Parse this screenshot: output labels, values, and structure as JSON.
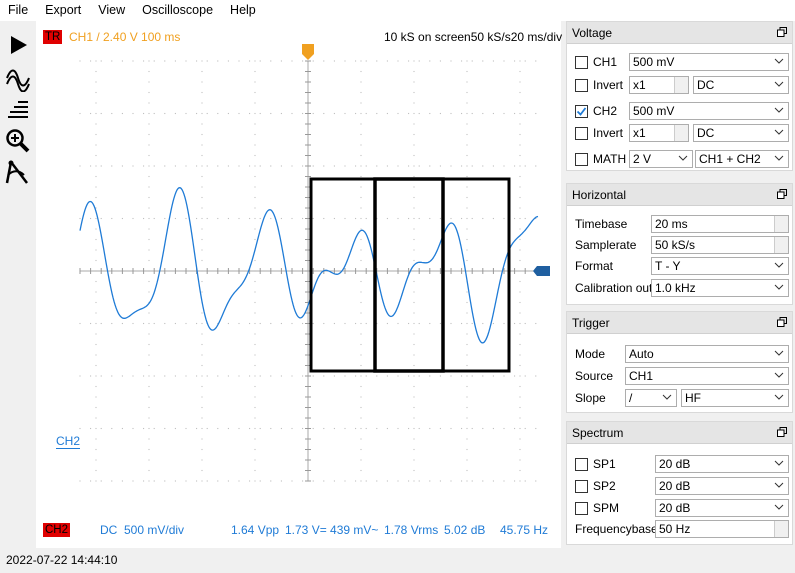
{
  "menu": [
    "File",
    "Export",
    "View",
    "Oscilloscope",
    "Help"
  ],
  "toolbar": [
    {
      "name": "run-icon"
    },
    {
      "name": "waveform-icon"
    },
    {
      "name": "filter-lines-icon"
    },
    {
      "name": "zoom-icon"
    },
    {
      "name": "measure-cursor-icon"
    }
  ],
  "scope": {
    "trigger_badge": "TR",
    "trigger_info": "CH1  /  2.40 V   100 ms",
    "top_right": "10 kS on screen50 kS/s20 ms/div",
    "ch2_marker": "CH2",
    "bottom_badge": "CH2",
    "bottom_coupling": "DC",
    "bottom_scale": "500 mV/div",
    "meas_vpp": "1.64 Vpp",
    "meas_v": "1.73 V= 439 mV~",
    "meas_vrms": "1.78 Vrms",
    "meas_db": "5.02 dB",
    "meas_hz": "45.75 Hz",
    "colors": {
      "ch2": "#1f7bd6",
      "trigger": "#f0a020",
      "badge": "#e00000"
    }
  },
  "voltage": {
    "title": "Voltage",
    "ch1": {
      "label": "CH1",
      "checked": false,
      "gain": "500 mV"
    },
    "invert1": {
      "label": "Invert",
      "checked": false,
      "mult": "x1",
      "coupling": "DC"
    },
    "ch2": {
      "label": "CH2",
      "checked": true,
      "gain": "500 mV"
    },
    "invert2": {
      "label": "Invert",
      "checked": false,
      "mult": "x1",
      "coupling": "DC"
    },
    "math": {
      "label": "MATH",
      "checked": false,
      "gain": "2 V",
      "mode": "CH1 + CH2"
    }
  },
  "horizontal": {
    "title": "Horizontal",
    "timebase_label": "Timebase",
    "timebase": "20 ms",
    "samplerate_label": "Samplerate",
    "samplerate": "50 kS/s",
    "format_label": "Format",
    "format": "T - Y",
    "calib_label": "Calibration out",
    "calib": "1.0 kHz"
  },
  "trigger": {
    "title": "Trigger",
    "mode_label": "Mode",
    "mode": "Auto",
    "source_label": "Source",
    "source": "CH1",
    "slope_label": "Slope",
    "slope": "/",
    "filter": "HF"
  },
  "spectrum": {
    "title": "Spectrum",
    "sp1": {
      "label": "SP1",
      "checked": false,
      "value": "20 dB"
    },
    "sp2": {
      "label": "SP2",
      "checked": false,
      "value": "20 dB"
    },
    "spm": {
      "label": "SPM",
      "checked": false,
      "value": "20 dB"
    },
    "freqbase_label": "Frequencybase",
    "freqbase": "50 Hz"
  },
  "status": "2022-07-22 14:44:10"
}
